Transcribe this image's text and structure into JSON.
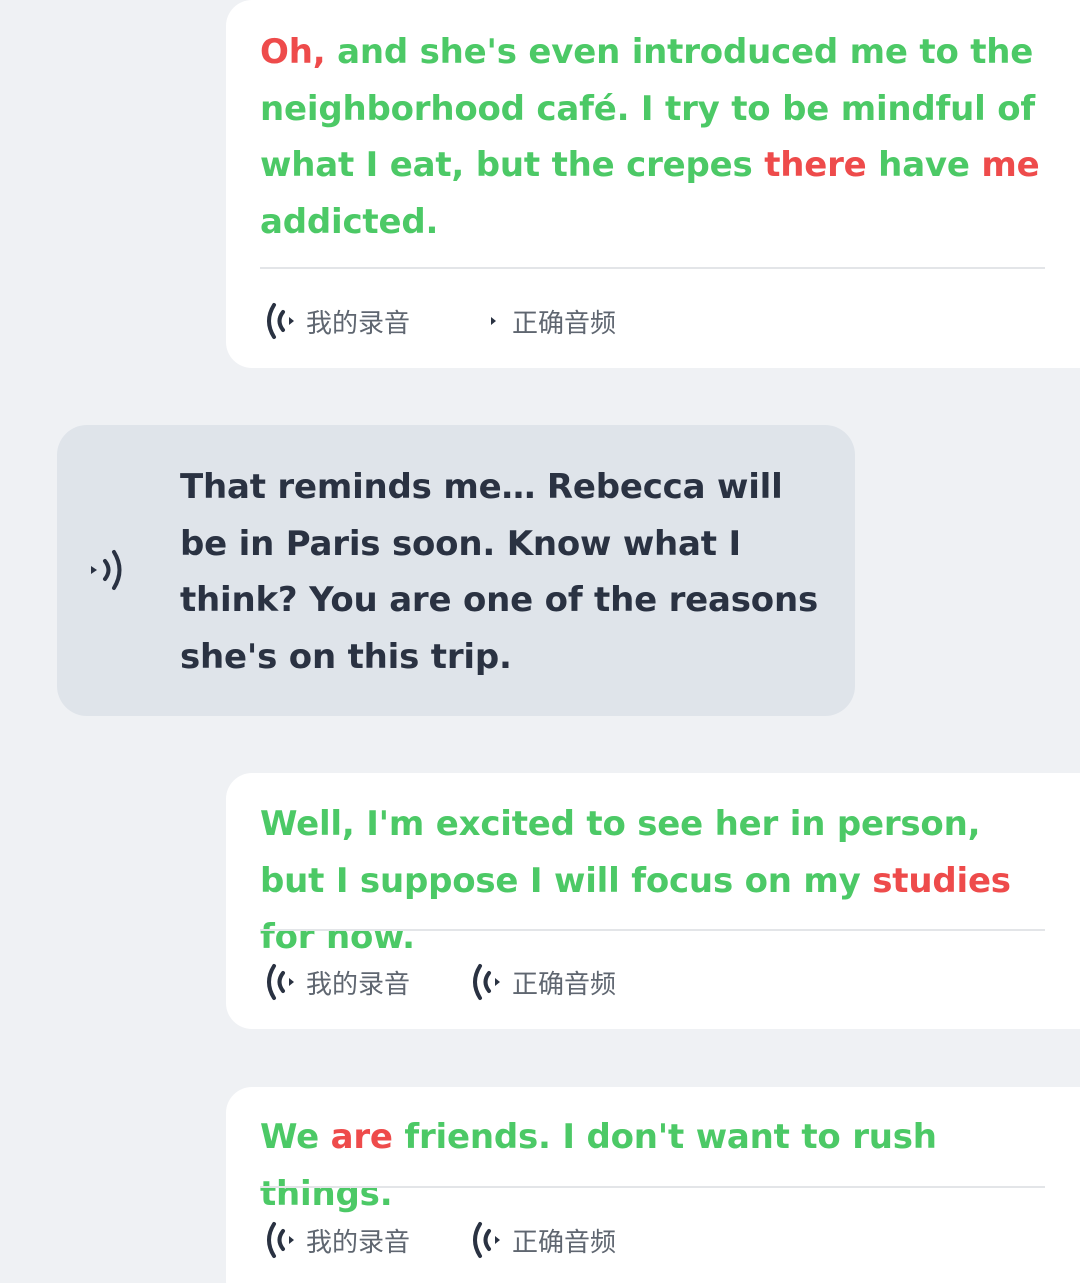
{
  "messages": [
    {
      "role": "user",
      "segments": [
        {
          "text": "Oh,",
          "correct": false
        },
        {
          "text": " and she's even introduced me to the neighborhood café. I try to be mindful of what I eat, but the crepes ",
          "correct": true
        },
        {
          "text": "there",
          "correct": false
        },
        {
          "text": " have ",
          "correct": true
        },
        {
          "text": "me",
          "correct": false
        },
        {
          "text": " addicted.",
          "correct": true
        }
      ],
      "record_label": "我的录音",
      "correct_label": "正确音频"
    },
    {
      "role": "bot",
      "text": "That reminds me… Rebecca will be in Paris soon. Know what I think? You are one of the reasons she's on this trip."
    },
    {
      "role": "user",
      "segments": [
        {
          "text": "Well, I'm excited to see her in person, but I suppose I will focus on my ",
          "correct": true
        },
        {
          "text": "studies",
          "correct": false
        },
        {
          "text": " for now.",
          "correct": true
        }
      ],
      "record_label": "我的录音",
      "correct_label": "正确音频"
    },
    {
      "role": "user",
      "segments": [
        {
          "text": "We ",
          "correct": true
        },
        {
          "text": "are",
          "correct": false
        },
        {
          "text": " friends. I don't want to rush things.",
          "correct": true
        }
      ],
      "record_label": "我的录音",
      "correct_label": "正确音频"
    }
  ],
  "icons": {
    "record": "audio-wave-icon",
    "correct_playing": "audio-playing-icon",
    "correct": "audio-wave-icon",
    "speaker": "speaker-icon"
  },
  "colors": {
    "correct_word": "#4cc966",
    "wrong_word": "#ee4b4b",
    "bot_bubble": "#dfe4ea",
    "background": "#eff1f4",
    "icon": "#2a3242"
  }
}
